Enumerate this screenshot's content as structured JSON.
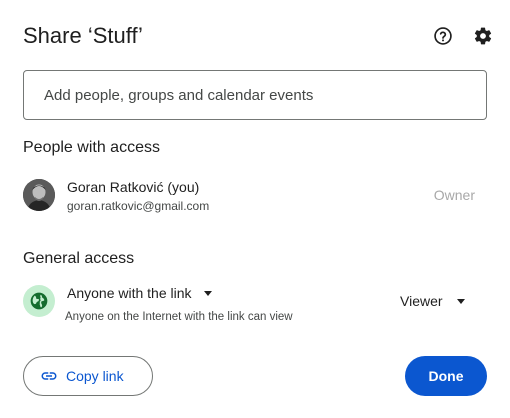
{
  "dialog": {
    "title": "Share ‘Stuff’",
    "help_icon": "help-circle-icon",
    "settings_icon": "gear-icon"
  },
  "share_input": {
    "placeholder": "Add people, groups and calendar events",
    "value": ""
  },
  "people_with_access": {
    "heading": "People with access",
    "people": [
      {
        "name": "Goran Ratković (you)",
        "email": "goran.ratkovic@gmail.com",
        "role": "Owner"
      }
    ]
  },
  "general_access": {
    "heading": "General access",
    "icon": "globe-icon",
    "access_level": "Anyone with the link",
    "description": "Anyone on the Internet with the link can view",
    "role": "Viewer"
  },
  "footer": {
    "copy_link_label": "Copy link",
    "copy_link_icon": "link-icon",
    "done_label": "Done"
  },
  "colors": {
    "primary": "#0b57d0",
    "globe_bg": "#c4eed0",
    "globe_fg": "#146c2e",
    "text": "#1f1f1f",
    "muted": "#444746",
    "owner_role": "#a8a8a8"
  }
}
